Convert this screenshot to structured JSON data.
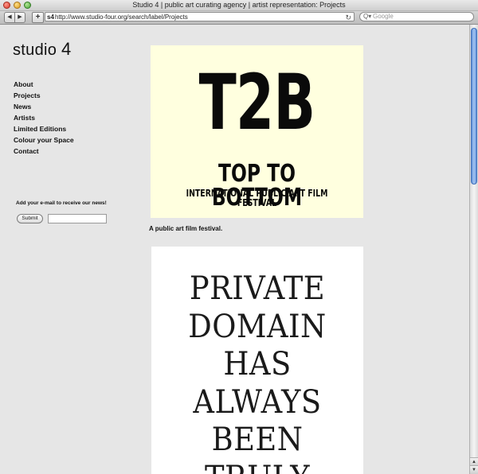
{
  "window": {
    "title": "Studio 4 | public art curating agency | artist representation: Projects"
  },
  "toolbar": {
    "back_glyph": "◀",
    "forward_glyph": "▶",
    "add_glyph": "+",
    "favicon": "s4",
    "url": "http://www.studio-four.org/search/label/Projects",
    "reload_glyph": "↻",
    "search_placeholder": "Google",
    "search_glyph": "Q▾"
  },
  "site": {
    "logo_text": "studio ",
    "logo_num": "4"
  },
  "nav": {
    "items": [
      {
        "label": "About"
      },
      {
        "label": "Projects"
      },
      {
        "label": "News"
      },
      {
        "label": "Artists"
      },
      {
        "label": "Limited Editions"
      },
      {
        "label": "Colour your Space"
      },
      {
        "label": "Contact"
      }
    ]
  },
  "newsletter": {
    "label": "Add your e-mail to receive our news!",
    "submit_label": "Submit",
    "email_value": ""
  },
  "posts": [
    {
      "poster_title": "T2B",
      "poster_subtitle": "TOP TO BOTTOM",
      "poster_tagline": "INTERNATIONAL PUBLIC ART FILM FESTIVAL",
      "caption": "A public art film festival.",
      "background": "#ffffdf"
    },
    {
      "poster_lines": [
        "PRIVATE",
        "DOMAIN",
        "HAS",
        "ALWAYS",
        "BEEN",
        "TRULY"
      ]
    }
  ],
  "scrollbar": {
    "up_glyph": "▲",
    "down_glyph": "▼",
    "accent": "#5d8fd8"
  }
}
